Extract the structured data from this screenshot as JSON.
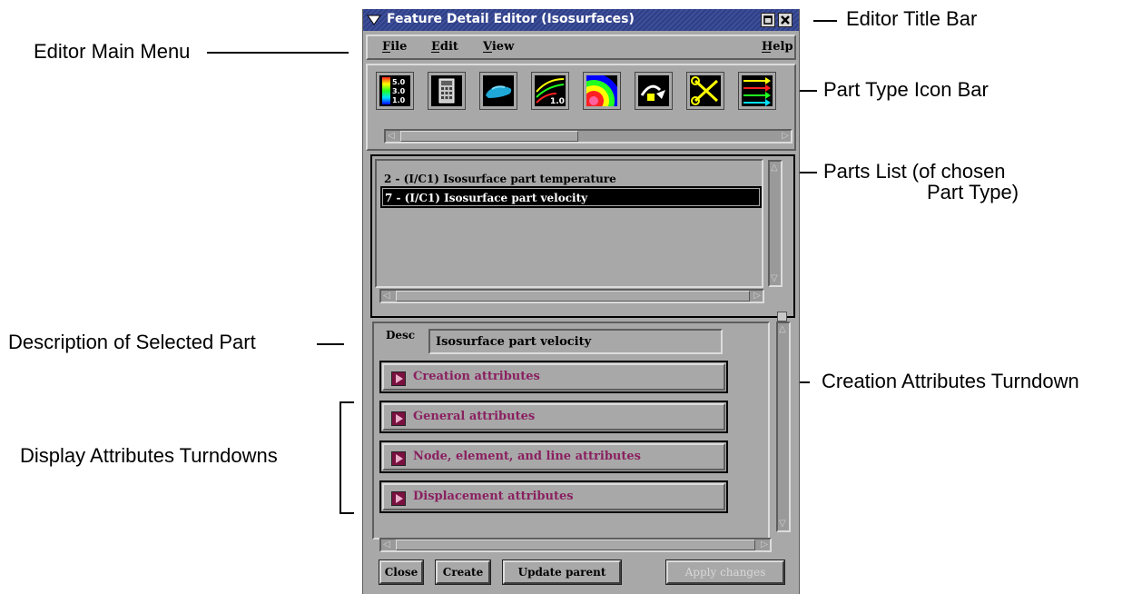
{
  "window": {
    "title": "Feature Detail Editor (Isosurfaces)"
  },
  "menu": {
    "file": "File",
    "edit": "Edit",
    "view": "View",
    "help": "Help"
  },
  "icon_bar": {
    "icons": [
      "color-legend-icon",
      "calculator-icon",
      "car-model-icon",
      "line-plot-icon",
      "contour-icon",
      "isosurface-arrow-icon",
      "scissors-clip-icon",
      "streamline-icon"
    ],
    "legend_values": [
      "5.0",
      "3.0",
      "1.0"
    ],
    "plot_value": "1.0"
  },
  "parts_list": {
    "items": [
      {
        "label": "2 - (I/C1) Isosurface part temperature",
        "selected": false
      },
      {
        "label": "7 - (I/C1) Isosurface part velocity",
        "selected": true
      }
    ]
  },
  "desc": {
    "label": "Desc",
    "value": "Isosurface part velocity"
  },
  "turndowns": {
    "creation": "Creation attributes",
    "general": "General attributes",
    "node": "Node, element, and line attributes",
    "displacement": "Displacement attributes"
  },
  "buttons": {
    "close": "Close",
    "create": "Create",
    "update_parent": "Update parent",
    "apply_changes": "Apply changes"
  },
  "callouts": {
    "title_bar": "Editor Title Bar",
    "main_menu": "Editor Main Menu",
    "icon_bar": "Part Type Icon Bar",
    "parts_list_1": "Parts List (of chosen",
    "parts_list_2": "Part Type)",
    "description": "Description of Selected Part",
    "creation_turndown": "Creation Attributes Turndown",
    "display_turndowns": "Display Attributes Turndowns"
  },
  "colors": {
    "title_bar": "#2f3f86",
    "panel": "#a8a8a8",
    "turndown_text": "#8a2060",
    "selection": "#000000"
  }
}
